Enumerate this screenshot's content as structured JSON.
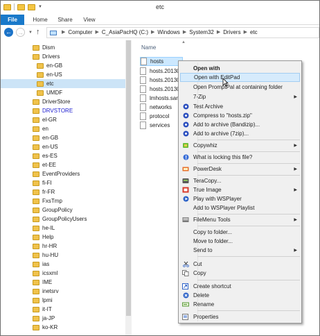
{
  "window": {
    "title": "etc"
  },
  "ribbon": {
    "tabs": [
      "File",
      "Home",
      "Share",
      "View"
    ]
  },
  "address": {
    "back_icon": "back-arrow-icon",
    "forward_icon": "forward-arrow-icon",
    "crumbs": [
      "Computer",
      "C_AsiaPacHQ (C:)",
      "Windows",
      "System32",
      "Drivers",
      "etc"
    ]
  },
  "tree": {
    "items": [
      {
        "label": "Dism"
      },
      {
        "label": "Drivers"
      },
      {
        "label": "en-GB"
      },
      {
        "label": "en-US"
      },
      {
        "label": "etc"
      },
      {
        "label": "UMDF"
      },
      {
        "label": "DriverStore"
      },
      {
        "label": "DRVSTORE"
      },
      {
        "label": "el-GR"
      },
      {
        "label": "en"
      },
      {
        "label": "en-GB"
      },
      {
        "label": "en-US"
      },
      {
        "label": "es-ES"
      },
      {
        "label": "et-EE"
      },
      {
        "label": "EventProviders"
      },
      {
        "label": "fi-FI"
      },
      {
        "label": "fr-FR"
      },
      {
        "label": "FxsTmp"
      },
      {
        "label": "GroupPolicy"
      },
      {
        "label": "GroupPolicyUsers"
      },
      {
        "label": "he-IL"
      },
      {
        "label": "Help"
      },
      {
        "label": "hr-HR"
      },
      {
        "label": "hu-HU"
      },
      {
        "label": "ias"
      },
      {
        "label": "icsxml"
      },
      {
        "label": "IME"
      },
      {
        "label": "inetsrv"
      },
      {
        "label": "lpmi"
      },
      {
        "label": "it-IT"
      },
      {
        "label": "ja-JP"
      },
      {
        "label": "ko-KR"
      }
    ]
  },
  "content": {
    "column_header": "Name",
    "files": [
      {
        "label": "hosts"
      },
      {
        "label": "hosts.20130"
      },
      {
        "label": "hosts.20130"
      },
      {
        "label": "hosts.20130"
      },
      {
        "label": "lmhosts.sar"
      },
      {
        "label": "networks"
      },
      {
        "label": "protocol"
      },
      {
        "label": "services"
      }
    ]
  },
  "context_menu": {
    "items": [
      {
        "label": "Open with",
        "bold": true
      },
      {
        "label": "Open with EditPad",
        "highlighted": true
      },
      {
        "label": "Open PromptPal at containing folder"
      },
      {
        "label": "7-Zip",
        "submenu": true
      },
      {
        "label": "Test Archive",
        "icon": "bandizip-icon"
      },
      {
        "label": "Compress to \"hosts.zip\"",
        "icon": "bandizip-icon"
      },
      {
        "label": "Add to archive (Bandizip)...",
        "icon": "bandizip-icon"
      },
      {
        "label": "Add to archive (7zip)...",
        "icon": "bandizip-icon"
      },
      {
        "label": "Copywhiz",
        "icon": "copywhiz-icon",
        "submenu": true
      },
      {
        "label": "What is locking this file?",
        "icon": "lock-search-icon"
      },
      {
        "label": "PowerDesk",
        "icon": "powerdesk-icon",
        "submenu": true
      },
      {
        "label": "TeraCopy...",
        "icon": "teracopy-icon"
      },
      {
        "label": "True Image",
        "icon": "trueimage-icon",
        "submenu": true
      },
      {
        "label": "Play with WSPlayer",
        "icon": "wsplayer-icon"
      },
      {
        "label": "Add to WSPlayer Playlist"
      },
      {
        "label": "FileMenu Tools",
        "icon": "filemenu-tools-icon",
        "submenu": true
      },
      {
        "label": "Copy to folder..."
      },
      {
        "label": "Move to folder..."
      },
      {
        "label": "Send to",
        "submenu": true
      },
      {
        "label": "Cut",
        "icon": "cut-icon"
      },
      {
        "label": "Copy",
        "icon": "copy-icon"
      },
      {
        "label": "Create shortcut",
        "icon": "shortcut-icon"
      },
      {
        "label": "Delete",
        "icon": "delete-icon"
      },
      {
        "label": "Rename",
        "icon": "rename-icon"
      },
      {
        "label": "Properties",
        "icon": "properties-icon"
      }
    ]
  },
  "colors": {
    "accent": "#1979ca",
    "selection": "#cce8ff",
    "compressed_folder_text": "#1c1ccf"
  }
}
